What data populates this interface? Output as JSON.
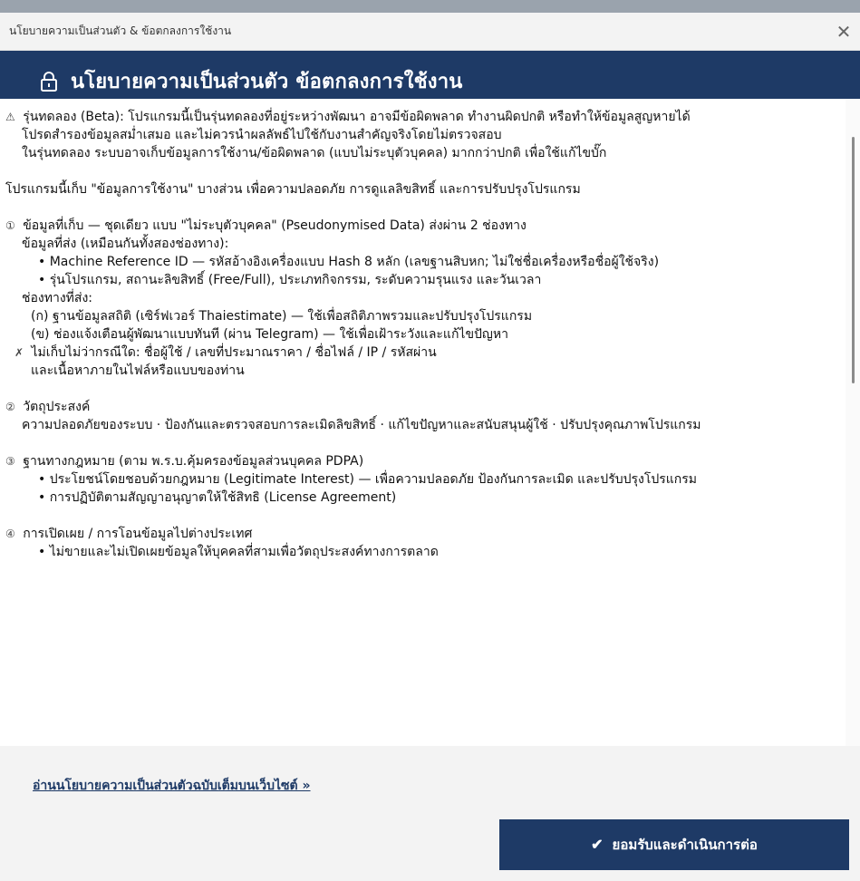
{
  "window": {
    "title": "นโยบายความเป็นส่วนตัว & ข้อตกลงการใช้งาน",
    "close_glyph": "✕"
  },
  "banner": {
    "icon": "lock-icon",
    "title": "นโยบายความเป็นส่วนตัว  ข้อตกลงการใช้งาน"
  },
  "content": {
    "beta": {
      "symbol": "⚠",
      "text": "รุ่นทดลอง (Beta): โปรแกรมนี้เป็นรุ่นทดลองที่อยู่ระหว่างพัฒนา อาจมีข้อผิดพลาด ทำงานผิดปกติ หรือทำให้ข้อมูลสูญหายได้",
      "line2": "โปรดสำรองข้อมูลสม่ำเสมอ และไม่ควรนำผลลัพธ์ไปใช้กับงานสำคัญจริงโดยไม่ตรวจสอบ",
      "line3": "ในรุ่นทดลอง ระบบอาจเก็บข้อมูลการใช้งาน/ข้อผิดพลาด (แบบไม่ระบุตัวบุคคล) มากกว่าปกติ เพื่อใช้แก้ไขบั๊ก"
    },
    "intro": "โปรแกรมนี้เก็บ \"ข้อมูลการใช้งาน\" บางส่วน เพื่อความปลอดภัย การดูแลลิขสิทธิ์ และการปรับปรุงโปรแกรม",
    "section1": {
      "symbol": "①",
      "heading": "ข้อมูลที่เก็บ — ชุดเดียว แบบ \"ไม่ระบุตัวบุคคล\" (Pseudonymised Data) ส่งผ่าน 2 ช่องทาง",
      "sent_heading": "ข้อมูลที่ส่ง (เหมือนกันทั้งสองช่องทาง):",
      "bullet1": "• Machine Reference ID — รหัสอ้างอิงเครื่องแบบ Hash 8 หลัก (เลขฐานสิบหก; ไม่ใช่ชื่อเครื่องหรือชื่อผู้ใช้จริง)",
      "bullet2": "• รุ่นโปรแกรม, สถานะลิขสิทธิ์ (Free/Full), ประเภทกิจกรรม, ระดับความรุนแรง และวันเวลา",
      "channels_heading": "ช่องทางที่ส่ง:",
      "channel_a": "(ก)  ฐานข้อมูลสถิติ (เซิร์ฟเวอร์ Thaiestimate) — ใช้เพื่อสถิติภาพรวมและปรับปรุงโปรแกรม",
      "channel_b": "(ข)  ช่องแจ้งเตือนผู้พัฒนาแบบทันที (ผ่าน Telegram) — ใช้เพื่อเฝ้าระวังและแก้ไขปัญหา",
      "no_symbol": "✗",
      "not_collected": "ไม่เก็บไม่ว่ากรณีใด: ชื่อผู้ใช้ / เลขที่ประมาณราคา / ชื่อไฟล์ / IP / รหัสผ่าน",
      "not_collected2": "และเนื้อหาภายในไฟล์หรือแบบของท่าน"
    },
    "section2": {
      "symbol": "②",
      "heading": "วัตถุประสงค์",
      "text": "ความปลอดภัยของระบบ · ป้องกันและตรวจสอบการละเมิดลิขสิทธิ์ · แก้ไขปัญหาและสนับสนุนผู้ใช้ · ปรับปรุงคุณภาพโปรแกรม"
    },
    "section3": {
      "symbol": "③",
      "heading": "ฐานทางกฎหมาย (ตาม พ.ร.บ.คุ้มครองข้อมูลส่วนบุคคล PDPA)",
      "bullet1": "• ประโยชน์โดยชอบด้วยกฎหมาย (Legitimate Interest) — เพื่อความปลอดภัย ป้องกันการละเมิด และปรับปรุงโปรแกรม",
      "bullet2": "• การปฏิบัติตามสัญญาอนุญาตให้ใช้สิทธิ (License Agreement)"
    },
    "section4": {
      "symbol": "④",
      "heading": "การเปิดเผย / การโอนข้อมูลไปต่างประเทศ",
      "bullet1": "• ไม่ขายและไม่เปิดเผยข้อมูลให้บุคคลที่สามเพื่อวัตถุประสงค์ทางการตลาด"
    }
  },
  "footer": {
    "link_text": "อ่านนโยบายความเป็นส่วนตัวฉบับเต็มบนเว็บไซต์ »",
    "accept_label": "ยอมรับและดำเนินการต่อ",
    "accept_icon": "check-icon"
  }
}
